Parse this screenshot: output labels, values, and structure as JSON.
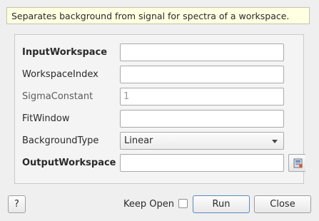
{
  "description": "Separates background from signal for spectra of a workspace.",
  "fields": {
    "input_workspace": {
      "label": "InputWorkspace",
      "value": ""
    },
    "workspace_index": {
      "label": "WorkspaceIndex",
      "value": ""
    },
    "sigma_constant": {
      "label": "SigmaConstant",
      "value": "",
      "placeholder": "1"
    },
    "fit_window": {
      "label": "FitWindow",
      "value": ""
    },
    "background_type": {
      "label": "BackgroundType",
      "selected": "Linear"
    },
    "output_workspace": {
      "label": "OutputWorkspace",
      "value": ""
    }
  },
  "buttons": {
    "help": "?",
    "keep_open_label": "Keep Open",
    "run": "Run",
    "close": "Close"
  },
  "keep_open_checked": false,
  "icons": {
    "browse": "workspace-browse-icon",
    "dropdown": "chevron-down-icon"
  }
}
